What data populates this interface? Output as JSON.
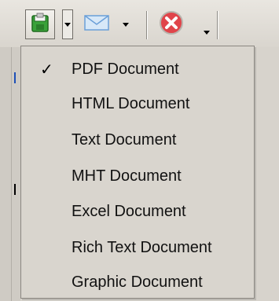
{
  "toolbar": {
    "buttons": [
      {
        "name": "save-button",
        "icon": "save-icon",
        "has_dropdown": true
      },
      {
        "name": "email-button",
        "icon": "mail-icon",
        "has_dropdown": true
      },
      {
        "name": "close-button",
        "icon": "close-icon",
        "has_dropdown": true
      }
    ]
  },
  "menu": {
    "items": [
      {
        "label": "PDF Document",
        "checked": true
      },
      {
        "label": "HTML Document",
        "checked": false
      },
      {
        "label": "Text Document",
        "checked": false
      },
      {
        "label": "MHT Document",
        "checked": false
      },
      {
        "label": "Excel Document",
        "checked": false
      },
      {
        "label": "Rich Text Document",
        "checked": false
      },
      {
        "label": "Graphic Document",
        "checked": false
      }
    ],
    "check_glyph": "✓"
  },
  "colors": {
    "toolbar_bg": "#dedad3",
    "menu_bg": "#d9d5ce",
    "save_green": "#3aa23a",
    "close_red": "#e0444a",
    "mail_blue": "#6a9fd8"
  }
}
